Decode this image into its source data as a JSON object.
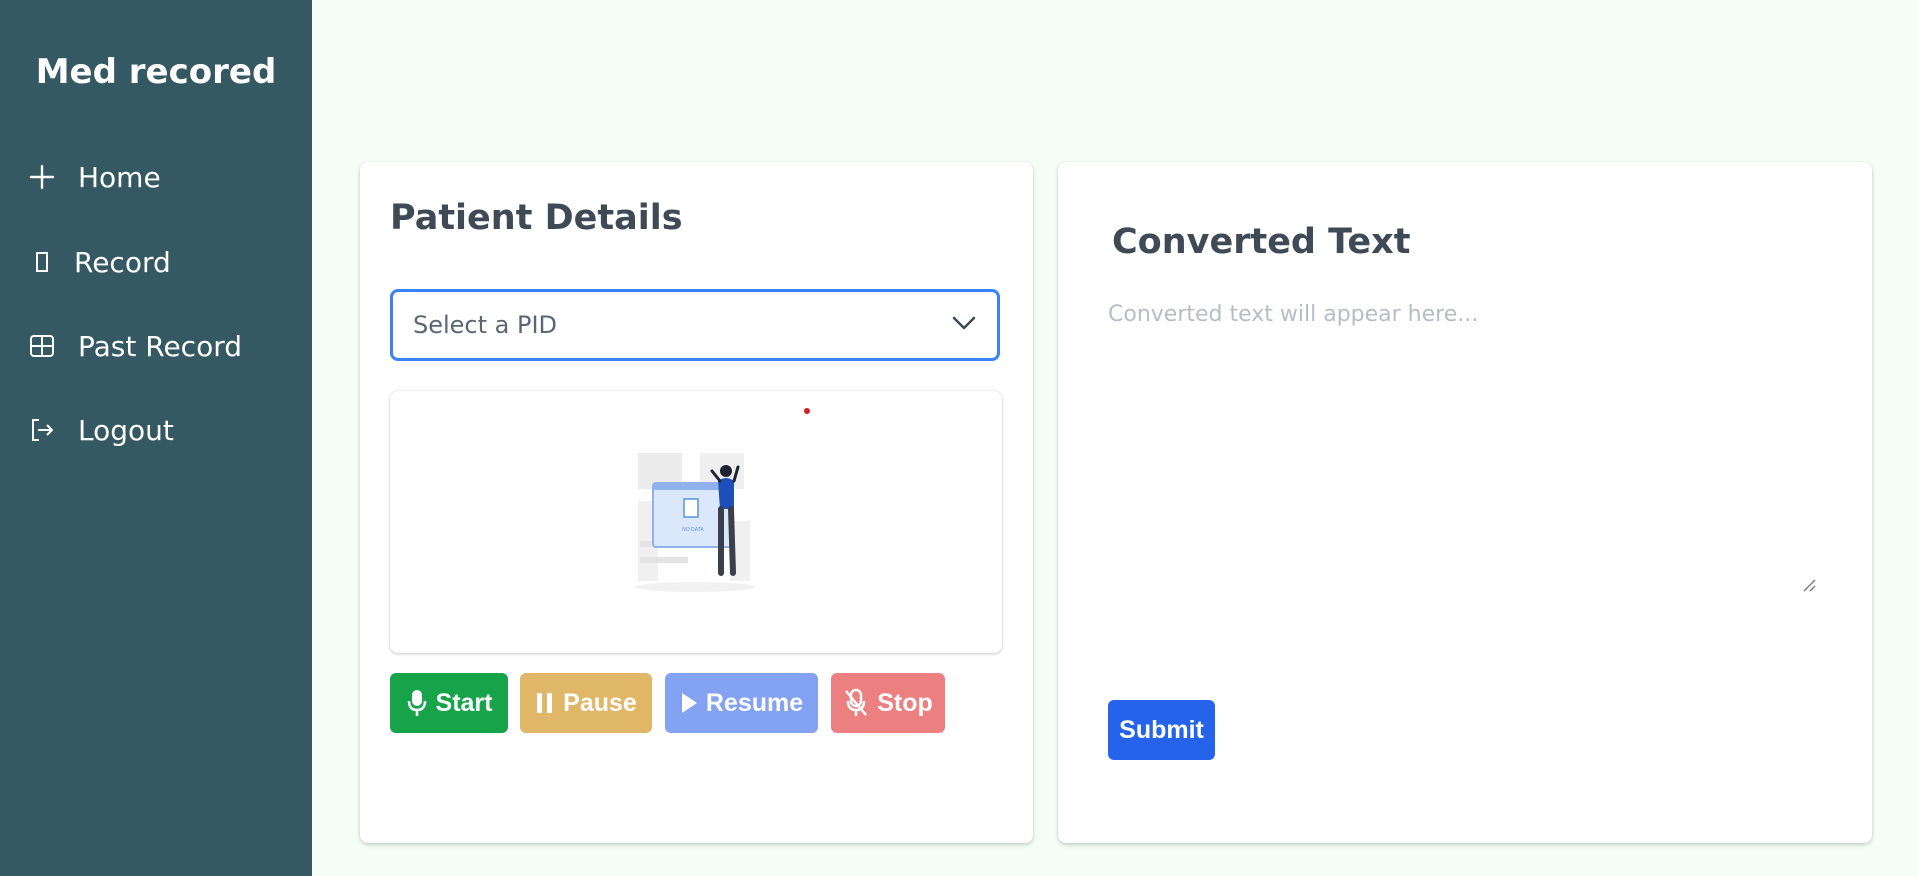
{
  "app": {
    "title": "Med recored"
  },
  "sidebar": {
    "items": [
      {
        "label": "Home",
        "icon": "plus-icon"
      },
      {
        "label": "Record",
        "icon": "rectangle-icon"
      },
      {
        "label": "Past Record",
        "icon": "grid-icon"
      },
      {
        "label": "Logout",
        "icon": "logout-icon"
      }
    ]
  },
  "patient": {
    "title": "Patient Details",
    "select": {
      "value": "Select a PID"
    },
    "illustration": {
      "caption": "NO DATA"
    },
    "buttons": {
      "start": "Start",
      "pause": "Pause",
      "resume": "Resume",
      "stop": "Stop"
    }
  },
  "converted": {
    "title": "Converted Text",
    "placeholder": "Converted text will appear here...",
    "submit": "Submit"
  },
  "colors": {
    "sidebar": "#345963",
    "start": "#16a34a",
    "pause": "#e0b767",
    "resume": "#83a2f1",
    "stop": "#ec8080",
    "submit": "#2563eb",
    "select_border": "#3b82f6"
  }
}
